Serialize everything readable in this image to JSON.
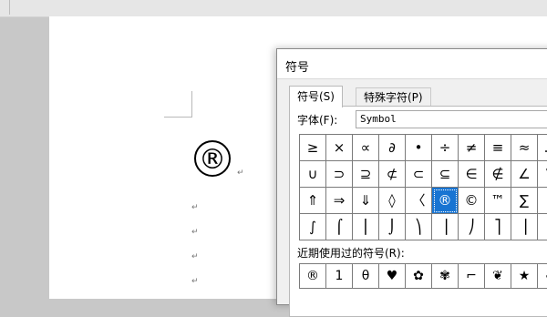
{
  "document": {
    "inserted_symbol": "®",
    "paragraph_mark": "↵",
    "paragraph_marks_after": [
      "↵",
      "↵",
      "↵",
      "↵"
    ]
  },
  "dialog": {
    "title": "符号",
    "tabs": [
      {
        "label": "符号(S)",
        "active": true
      },
      {
        "label": "特殊字符(P)",
        "active": false
      }
    ],
    "font_label": "字体(F):",
    "font_value": "Symbol",
    "symbol_grid": [
      [
        "≥",
        "×",
        "∝",
        "∂",
        "•",
        "÷",
        "≠",
        "≡",
        "≈",
        "…"
      ],
      [
        "∪",
        "⊃",
        "⊇",
        "⊄",
        "⊂",
        "⊆",
        "∈",
        "∉",
        "∠",
        "∇"
      ],
      [
        "⇑",
        "⇒",
        "⇓",
        "◊",
        "〈",
        "®",
        "©",
        "™",
        "∑",
        "⎛"
      ],
      [
        "∫",
        "⌠",
        "⎮",
        "⌡",
        "⎞",
        "⎟",
        "⎠",
        "⎤",
        "⎥",
        "⎦"
      ]
    ],
    "selected_symbol": "®",
    "recent_label": "近期使用过的符号(R):",
    "recent_symbols": [
      "®",
      "1",
      "θ",
      "♥",
      "✿",
      "✾",
      "⌐",
      "❦",
      "★",
      "♣"
    ]
  }
}
